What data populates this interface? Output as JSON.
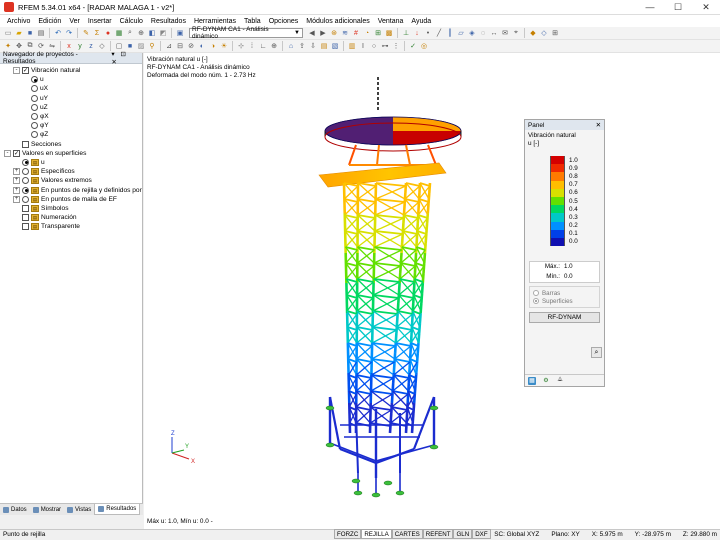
{
  "window": {
    "title": "RFEM 5.34.01 x64 - [RADAR MALAGA 1 - v2*]"
  },
  "menu": [
    "Archivo",
    "Edición",
    "Ver",
    "Insertar",
    "Cálculo",
    "Resultados",
    "Herramientas",
    "Tabla",
    "Opciones",
    "Módulos adicionales",
    "Ventana",
    "Ayuda"
  ],
  "toolbar": {
    "loadcase_combo": "RF-DYNAM CA1 - Análisis dinámico"
  },
  "navigator": {
    "title": "Navegador de proyectos - Resultados",
    "items": [
      {
        "label": "Vibración natural",
        "indent": 1,
        "exp": "-",
        "ctl": "chk",
        "on": true
      },
      {
        "label": "u",
        "indent": 2,
        "ctl": "radio",
        "on": true
      },
      {
        "label": "uX",
        "indent": 2,
        "ctl": "radio",
        "on": false
      },
      {
        "label": "uY",
        "indent": 2,
        "ctl": "radio",
        "on": false
      },
      {
        "label": "uZ",
        "indent": 2,
        "ctl": "radio",
        "on": false
      },
      {
        "label": "φX",
        "indent": 2,
        "ctl": "radio",
        "on": false
      },
      {
        "label": "φY",
        "indent": 2,
        "ctl": "radio",
        "on": false
      },
      {
        "label": "φZ",
        "indent": 2,
        "ctl": "radio",
        "on": false
      },
      {
        "label": "Secciones",
        "indent": 1,
        "ctl": "chk",
        "on": false
      },
      {
        "label": "Valores en superficies",
        "indent": 0,
        "exp": "-",
        "ctl": "chk",
        "on": true
      },
      {
        "label": "u",
        "indent": 1,
        "ctl": "radio",
        "on": true,
        "icon": true
      },
      {
        "label": "Específicos",
        "indent": 1,
        "exp": "+",
        "ctl": "radio",
        "on": false,
        "icon": true
      },
      {
        "label": "Valores extremos",
        "indent": 1,
        "exp": "+",
        "ctl": "radio",
        "on": false,
        "icon": true
      },
      {
        "label": "En puntos de rejilla y definidos por",
        "indent": 1,
        "exp": "+",
        "ctl": "radio",
        "on": true,
        "icon": true
      },
      {
        "label": "En puntos de malla de EF",
        "indent": 1,
        "exp": "+",
        "ctl": "radio",
        "on": false,
        "icon": true
      },
      {
        "label": "Símbolos",
        "indent": 1,
        "ctl": "chk",
        "on": false,
        "icon": true
      },
      {
        "label": "Numeración",
        "indent": 1,
        "ctl": "chk",
        "on": false,
        "icon": true
      },
      {
        "label": "Transparente",
        "indent": 1,
        "ctl": "chk",
        "on": false,
        "icon": true
      }
    ],
    "tabs": [
      {
        "label": "Datos",
        "active": false
      },
      {
        "label": "Mostrar",
        "active": false
      },
      {
        "label": "Vistas",
        "active": false
      },
      {
        "label": "Resultados",
        "active": true
      }
    ]
  },
  "viewport": {
    "info_line1": "Vibración natural  u [-]",
    "info_line2": "RF-DYNAM CA1 - Análisis dinámico",
    "info_line3": "Deformada del modo núm. 1 - 2.73 Hz",
    "footer": "Máx u: 1.0, Mín u: 0.0 -",
    "axis_labels": {
      "z": "Z",
      "y": "Y",
      "x": "X"
    }
  },
  "panel": {
    "title": "Panel",
    "result_label": "Vibración natural",
    "unit": "u [-]",
    "legend_values": [
      "1.0",
      "0.9",
      "0.8",
      "0.7",
      "0.6",
      "0.5",
      "0.4",
      "0.3",
      "0.2",
      "0.1",
      "0.0"
    ],
    "legend_colors": [
      "#d40000",
      "#f02a00",
      "#ff7b00",
      "#ffbe00",
      "#d8e000",
      "#62e000",
      "#00d860",
      "#00c8c8",
      "#0090ff",
      "#0040e8",
      "#1010b0"
    ],
    "max_label": "Máx.:",
    "max_value": "1.0",
    "min_label": "Mín.:",
    "min_value": "0.0",
    "option_bars": "Barras",
    "option_surfaces": "Superficies",
    "module_button": "RF-DYNAM"
  },
  "status_tabs": [
    {
      "label": "FORZC",
      "active": false
    },
    {
      "label": "REJILLA",
      "active": true
    },
    {
      "label": "CARTES",
      "active": false
    },
    {
      "label": "REFENT",
      "active": false
    },
    {
      "label": "GLN",
      "active": false
    },
    {
      "label": "DXF",
      "active": false
    }
  ],
  "statusbar": {
    "left": "Punto de rejilla",
    "cs": "SC: Global XYZ",
    "plane": "Plano: XY",
    "x": "X:   5.975 m",
    "y": "Y:  -28.975 m",
    "z": "Z:   29.880 m"
  }
}
